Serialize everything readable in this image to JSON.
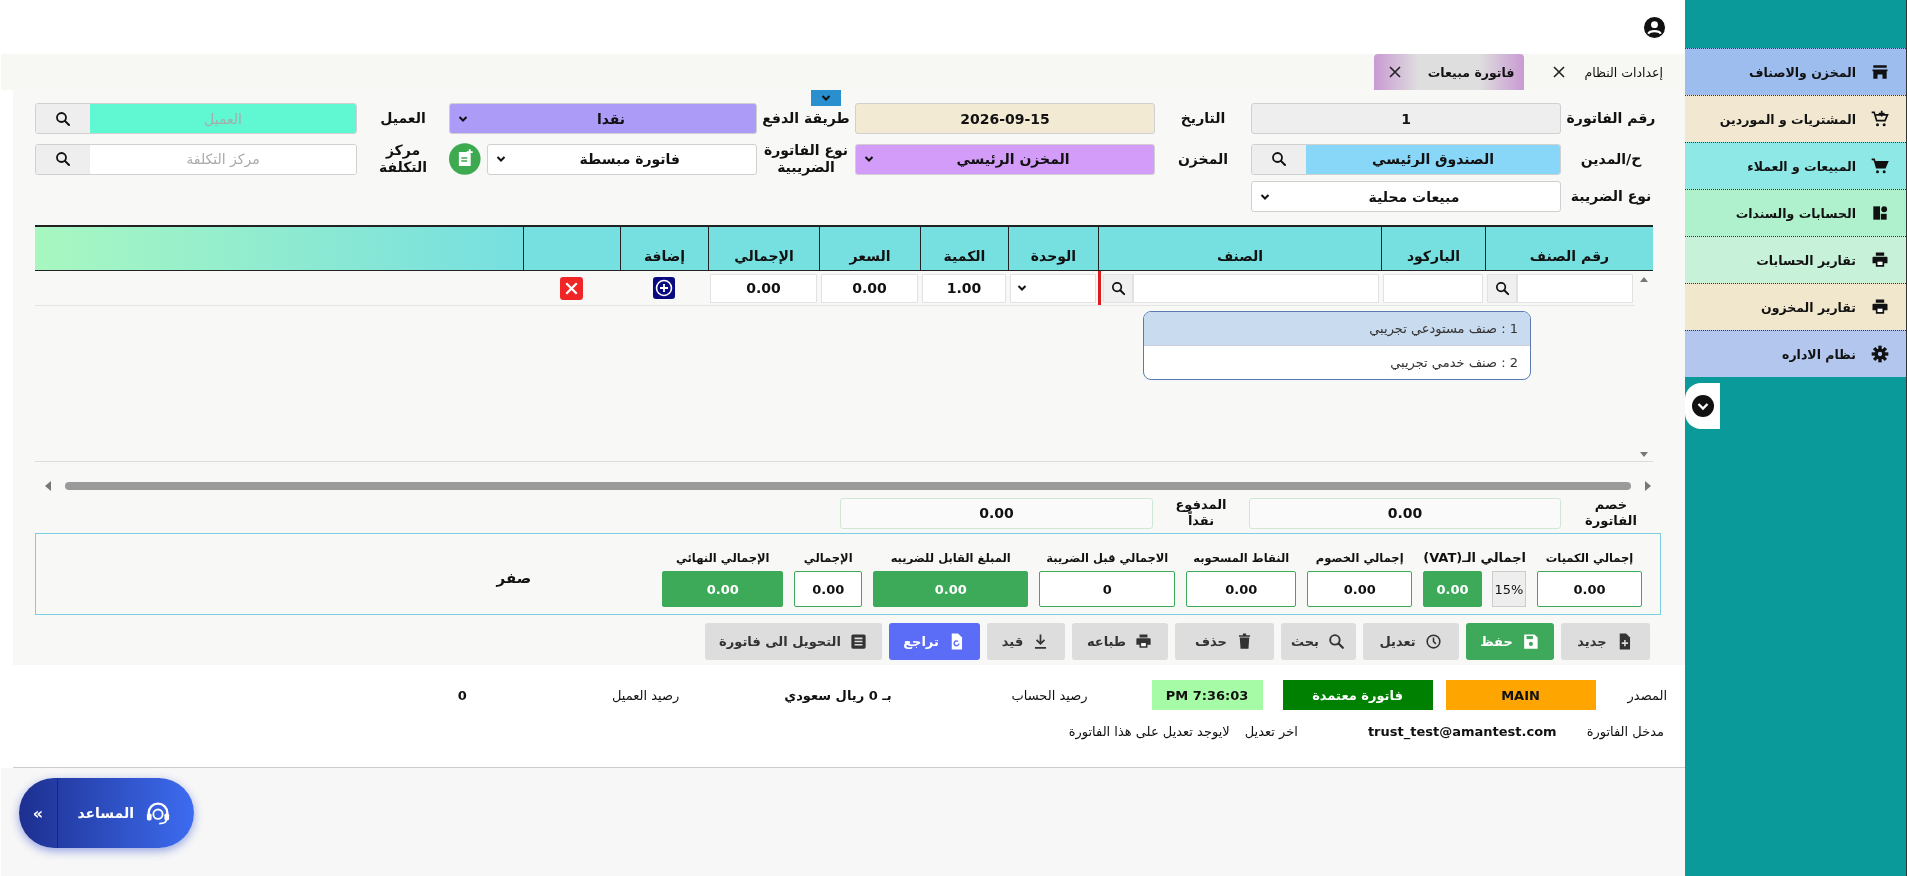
{
  "form_toggle": {
    "expanded": false
  },
  "tabs": [
    {
      "label": "إعدادات النظام",
      "selected": false
    },
    {
      "label": "فاتورة مبيعات",
      "selected": true
    }
  ],
  "form": [
    [
      {
        "label": "رقم الفاتورة",
        "kind": "text",
        "value": "1",
        "color": "#eeeeee"
      },
      {
        "label": "التاريخ",
        "kind": "text",
        "value": "2026-09-15",
        "color": "#f2ead3"
      },
      {
        "label": "طريقة الدفع",
        "kind": "select",
        "value": "نقدا",
        "color": "#ac9cf8"
      },
      {
        "label": "العميل",
        "kind": "search",
        "placeholder": "العميل",
        "color": "#5ff8d2"
      }
    ],
    [
      {
        "label": "ح/المدين",
        "kind": "search",
        "value": "الصندوق الرئيسي",
        "color": "#88d6f8"
      },
      {
        "label": "المخزن",
        "kind": "select",
        "value": "المخزن الرئيسي",
        "color": "#d29cf8"
      },
      {
        "label": "نوع الفاتورة الضريبية",
        "kind": "addselect",
        "value": "فاتورة مبسطة",
        "color": "#ffffff"
      },
      {
        "label": "مركز التكلفة",
        "kind": "search",
        "placeholder": "مركز التكلفة",
        "color": "#ffffff"
      }
    ],
    [
      {
        "label": "نوع الضريبة",
        "kind": "select",
        "value": "مبيعات محلية",
        "color": "#ffffff"
      }
    ]
  ],
  "table": {
    "columns": [
      "رقم الصنف",
      "الباركود",
      "الصنف",
      "الوحدة",
      "الكمية",
      "السعر",
      "الإجمالي",
      "إضافة"
    ],
    "rows": [
      {
        "quantity": "1.00",
        "price": "0.00",
        "total": "0.00"
      }
    ],
    "suggestions": [
      {
        "label": "1 : صنف مستودعي تجريبي",
        "selected": true
      },
      {
        "label": "2 : صنف خدمي تجريبي",
        "selected": false
      }
    ]
  },
  "totals": [
    {
      "label": "خصم الفاتورة",
      "value": "0.00"
    },
    {
      "label": "المدفوع نقداً",
      "value": "0.00"
    }
  ],
  "summary": {
    "items": [
      {
        "label": "إجمالي الكميات",
        "value": "0.00",
        "highlighted": false
      },
      {
        "label": "اجمالي الـ(VAT)",
        "rate": "15%",
        "value": "0.00",
        "highlighted": true
      },
      {
        "label": "إجمالي الخصوم",
        "value": "0.00",
        "highlighted": false
      },
      {
        "label": "النقاط المسحوبه",
        "value": "0.00",
        "highlighted": false
      },
      {
        "label": "الاجمالي قبل الضريبة",
        "value": "0",
        "highlighted": false
      },
      {
        "label": "المبلغ القابل للضريبه",
        "value": "0.00",
        "highlighted": true
      },
      {
        "label": "الإجمالي",
        "value": "0.00",
        "highlighted": false
      },
      {
        "label": "الإجمالي النهائي",
        "value": "0.00",
        "highlighted": true
      }
    ],
    "amount_in_words": "صفر"
  },
  "toolbar": [
    {
      "label": "جديد",
      "kind": "new",
      "color": "#dddddd"
    },
    {
      "label": "حفظ",
      "kind": "save",
      "color": "#3fa95b"
    },
    {
      "label": "تعديل",
      "kind": "edit",
      "color": "#dddddd"
    },
    {
      "label": "بحث",
      "kind": "search",
      "color": "#dddddd"
    },
    {
      "label": "حذف",
      "kind": "delete",
      "color": "#dddddd"
    },
    {
      "label": "طباعه",
      "kind": "print",
      "color": "#dddddd"
    },
    {
      "label": "قيد",
      "kind": "post",
      "color": "#dddddd"
    },
    {
      "label": "تراجع",
      "kind": "undo",
      "color": "#5b6cf6"
    },
    {
      "label": "التحويل الى فاتورة",
      "kind": "convert",
      "color": "#dddddd"
    }
  ],
  "status": [
    [
      {
        "kind": "label",
        "text": "المصدر"
      },
      {
        "kind": "badge",
        "text": "MAIN",
        "color": "#ffa500"
      },
      {
        "kind": "badge",
        "text": "فاتورة معتمدة",
        "color": "#008000"
      },
      {
        "kind": "badge",
        "text": "PM 7:36:03",
        "color": "#a6fba6"
      },
      {
        "kind": "label",
        "text": "رصيد الحساب"
      },
      {
        "kind": "value",
        "text": "بـ 0 ريال سعودي"
      },
      {
        "kind": "label",
        "text": "رصيد العميل"
      },
      {
        "kind": "value",
        "text": "0"
      }
    ],
    [
      {
        "kind": "label",
        "text": "مدخل الفاتورة"
      },
      {
        "kind": "value",
        "text": "trust_test@amantest.com"
      },
      {
        "kind": "label",
        "text": "اخر تعديل"
      },
      {
        "kind": "label",
        "text": "لايوجد تعديل على هذا الفاتورة"
      }
    ]
  ],
  "assistant": {
    "label": "المساعد",
    "expand": "»"
  },
  "sidebar": [
    {
      "label": "المخزن والاصناف",
      "kind": "store",
      "color": "#9dbdee"
    },
    {
      "label": "المشتريات و الموردين",
      "kind": "cartadd",
      "color": "#f2e8d2"
    },
    {
      "label": "المبيعات و العملاء",
      "kind": "cart",
      "color": "#8de8e6"
    },
    {
      "label": "الحسابات والسندات",
      "kind": "accounts",
      "color": "#b0f1cd"
    },
    {
      "label": "تقارير الحسابات",
      "kind": "print",
      "color": "#c8f1da"
    },
    {
      "label": "تقارير المخزون",
      "kind": "print",
      "color": "#f1e7cd"
    },
    {
      "label": "نظام الاداره",
      "kind": "gear",
      "color": "#b2c6ee"
    }
  ]
}
